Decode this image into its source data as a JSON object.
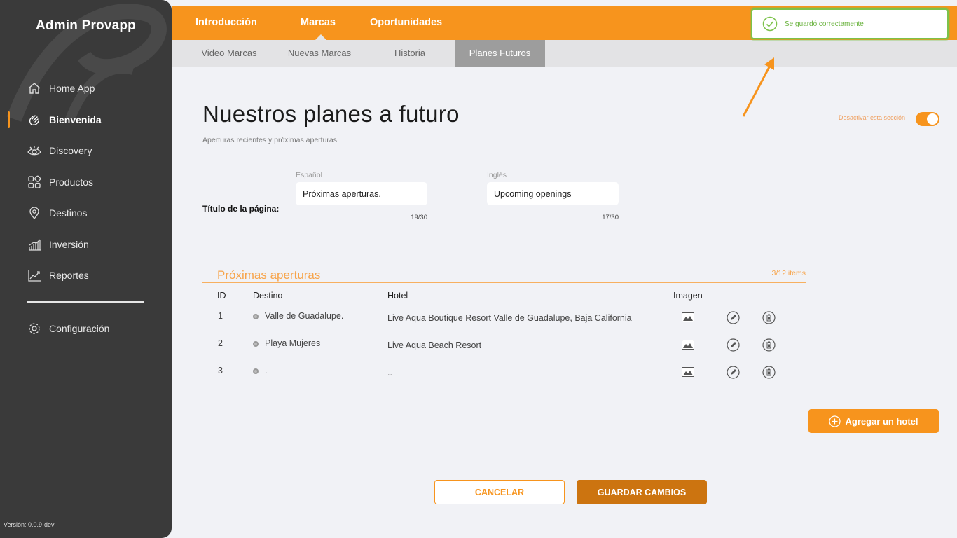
{
  "sidebar": {
    "title": "Admin Provapp",
    "items": [
      {
        "label": "Home App",
        "icon": "home-icon"
      },
      {
        "label": "Bienvenida",
        "icon": "waving-hand-icon",
        "active": true
      },
      {
        "label": "Discovery",
        "icon": "eye-icon"
      },
      {
        "label": "Productos",
        "icon": "grid-icon"
      },
      {
        "label": "Destinos",
        "icon": "location-pin-icon"
      },
      {
        "label": "Inversión",
        "icon": "bar-chart-icon"
      },
      {
        "label": "Reportes",
        "icon": "line-chart-icon"
      }
    ],
    "config_label": "Configuración",
    "version": "Versión: 0.0.9-dev"
  },
  "topbar": {
    "tabs": [
      "Introducción",
      "Marcas",
      "Oportunidades"
    ],
    "active_tab": "Marcas"
  },
  "subbar": {
    "tabs": [
      "Video Marcas",
      "Nuevas Marcas",
      "Historia",
      "Planes Futuros"
    ],
    "active_tab": "Planes Futuros"
  },
  "toast": {
    "message": "Se guardó correctamente",
    "color": "#7cc24a"
  },
  "page": {
    "title": "Nuestros planes a futuro",
    "subtitle": "Aperturas recientes y próximas aperturas.",
    "toggle_label": "Desactivar esta sección",
    "toggle_on": true
  },
  "title_field": {
    "row_label": "Título de la página:",
    "spanish_label": "Español",
    "spanish_value": "Próximas aperturas.",
    "spanish_counter": "19/30",
    "english_label": "Inglés",
    "english_value": "Upcoming openings",
    "english_counter": "17/30"
  },
  "section": {
    "title": "Próximas aperturas",
    "count": "3/12 items",
    "headers": {
      "id": "ID",
      "destino": "Destino",
      "hotel": "Hotel",
      "imagen": "Imagen"
    },
    "rows": [
      {
        "id": "1",
        "destino": "Valle de Guadalupe.",
        "hotel": "Live Aqua Boutique Resort Valle de Guadalupe, Baja California"
      },
      {
        "id": "2",
        "destino": "Playa Mujeres",
        "hotel": "Live Aqua Beach Resort"
      },
      {
        "id": "3",
        "destino": ".",
        "hotel": ".."
      }
    ]
  },
  "actions": {
    "add_hotel": "Agregar un hotel",
    "cancel": "CANCELAR",
    "save": "GUARDAR CAMBIOS"
  },
  "colors": {
    "accent": "#f7941d",
    "sidebar_bg": "#3a3a3a",
    "save_button": "#cc7410"
  }
}
